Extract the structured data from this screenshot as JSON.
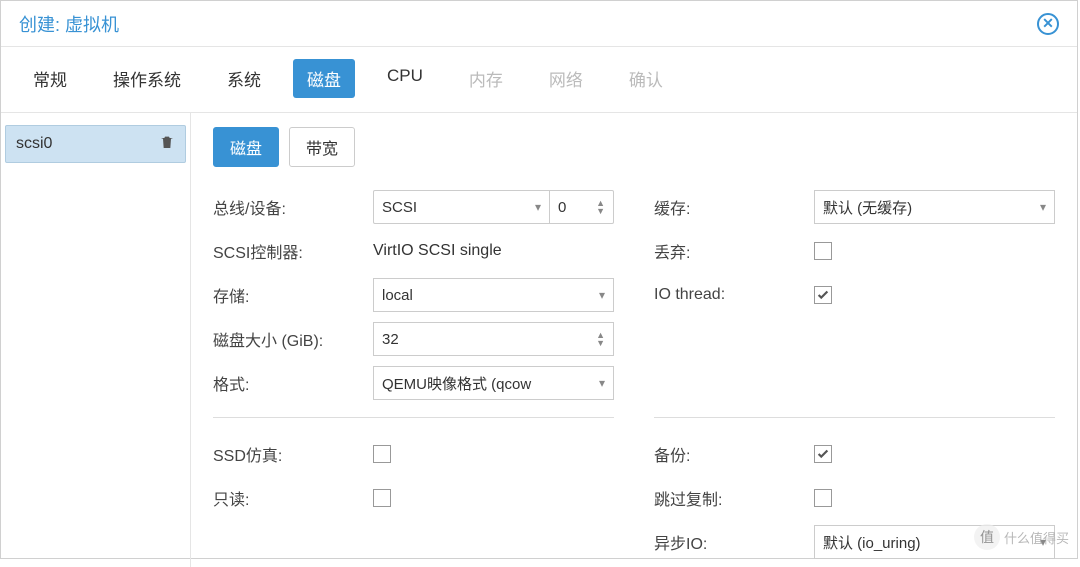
{
  "window_title": "创建: 虚拟机",
  "tabs": {
    "general": "常规",
    "os": "操作系统",
    "system": "系统",
    "disk": "磁盘",
    "cpu": "CPU",
    "memory": "内存",
    "network": "网络",
    "confirm": "确认"
  },
  "sidebar": {
    "item0": "scsi0"
  },
  "subtabs": {
    "disk": "磁盘",
    "bandwidth": "带宽"
  },
  "left": {
    "bus_label": "总线/设备:",
    "bus_value": "SCSI",
    "bus_index": "0",
    "scsi_ctrl_label": "SCSI控制器:",
    "scsi_ctrl_value": "VirtIO SCSI single",
    "storage_label": "存储:",
    "storage_value": "local",
    "size_label": "磁盘大小 (GiB):",
    "size_value": "32",
    "format_label": "格式:",
    "format_value": "QEMU映像格式 (qcow",
    "ssd_label": "SSD仿真:",
    "readonly_label": "只读:"
  },
  "right": {
    "cache_label": "缓存:",
    "cache_value": "默认 (无缓存)",
    "discard_label": "丢弃:",
    "iothread_label": "IO thread:",
    "backup_label": "备份:",
    "skip_replicate_label": "跳过复制:",
    "aio_label": "异步IO:",
    "aio_value": "默认 (io_uring)"
  },
  "checkboxes": {
    "discard": false,
    "iothread": true,
    "ssd": false,
    "readonly": false,
    "backup": true,
    "skip_replicate": false
  },
  "watermark": {
    "badge": "值",
    "text": "什么值得买"
  }
}
